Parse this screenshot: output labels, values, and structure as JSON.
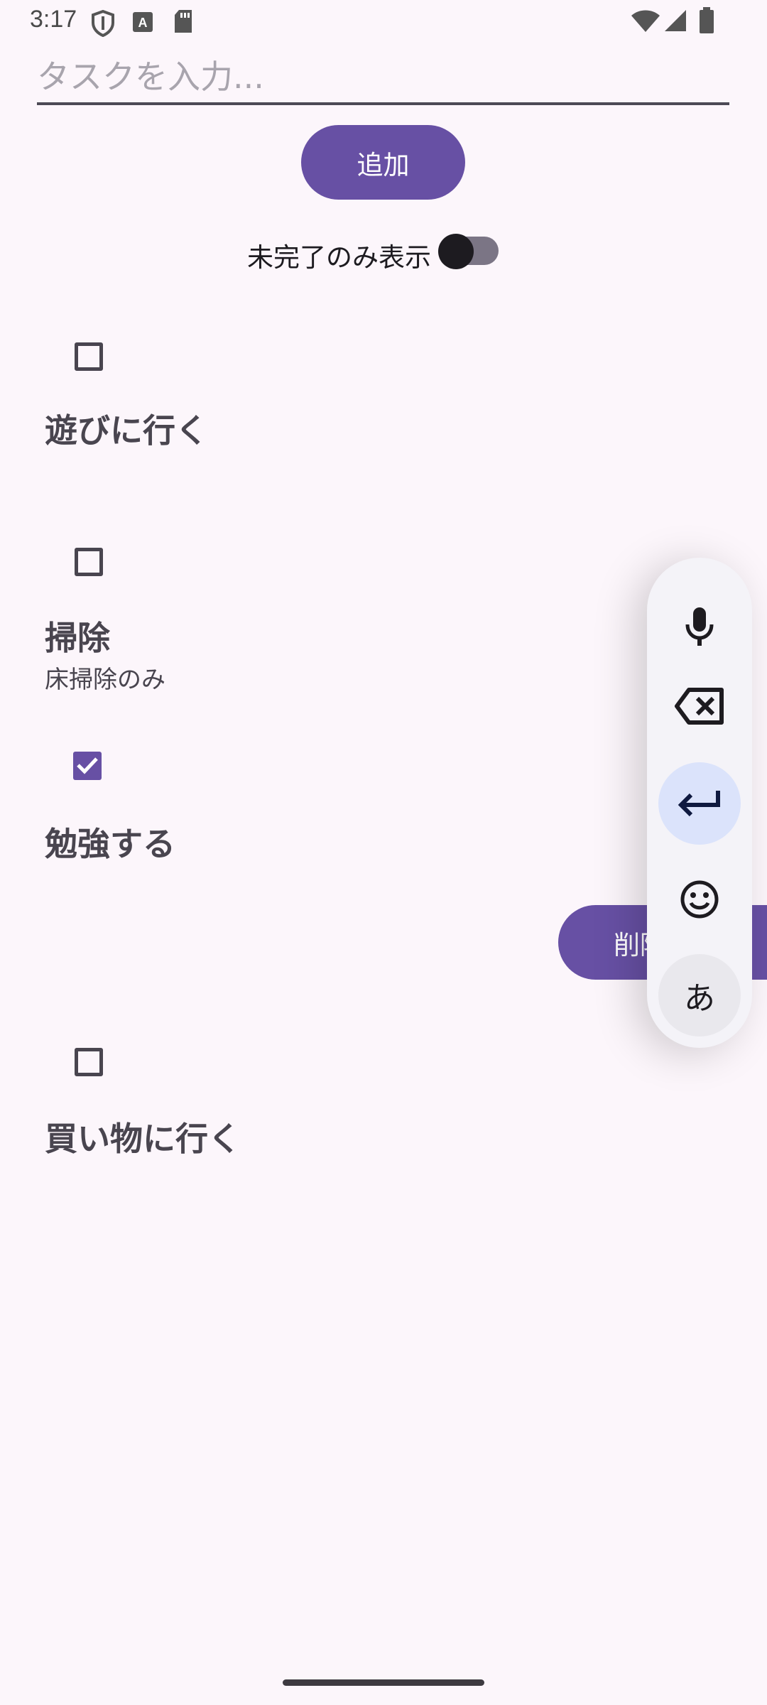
{
  "status_bar": {
    "time": "3:17",
    "left_icons": [
      "shield-icon",
      "font-a-icon",
      "sd-card-icon"
    ],
    "right_icons": [
      "wifi-icon",
      "cell-signal-icon",
      "battery-icon"
    ]
  },
  "input": {
    "placeholder": "タスクを入力...",
    "value": ""
  },
  "add_button": {
    "label": "追加"
  },
  "filter": {
    "label": "未完了のみ表示",
    "enabled": false
  },
  "tasks": [
    {
      "title": "遊びに行く",
      "note": "",
      "done": false
    },
    {
      "title": "掃除",
      "note": "床掃除のみ",
      "done": false
    },
    {
      "title": "勉強する",
      "note": "",
      "done": true,
      "action_label": "削除"
    },
    {
      "title": "買い物に行く",
      "note": "",
      "done": false
    }
  ],
  "keyboard_toolbar": {
    "buttons": [
      "mic-icon",
      "backspace-icon",
      "enter-icon",
      "emoji-icon",
      "kana-switch"
    ],
    "kana_label": "あ"
  },
  "colors": {
    "primary": "#6750a4",
    "background": "#fcf6fb",
    "on_surface": "#49454f"
  }
}
